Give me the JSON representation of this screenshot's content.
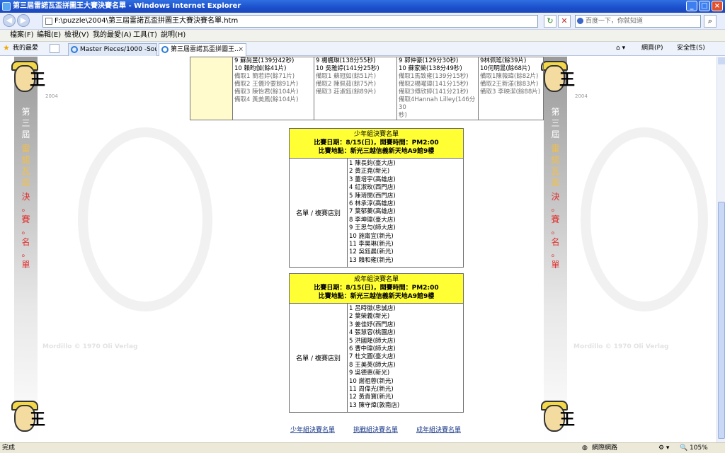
{
  "window": {
    "title": "第三屆雷諾瓦盃拼圖王大賽決賽名單 - Windows Internet Explorer"
  },
  "address": {
    "url": "F:\\puzzle\\2004\\第三屆雷諾瓦盃拼圖王大賽決賽名單.htm",
    "search_placeholder": "百度一下，你就知道"
  },
  "menu": [
    "檔案(F)",
    "編輯(E)",
    "檢視(V)",
    "我的最愛(A)",
    "工具(T)",
    "說明(H)"
  ],
  "favorites_label": "我的最愛",
  "tabs": [
    {
      "label": "Master Pieces/1000 -Soul of t..."
    },
    {
      "label": "第三屆雷諾瓦盃拼圖王..."
    }
  ],
  "toolbar_right": {
    "page": "網頁(P)",
    "safety": "安全性(S)"
  },
  "banner": {
    "vertical_top": [
      "第",
      "三",
      "屆"
    ],
    "vertical_gold": [
      "雷",
      "諾",
      "瓦",
      "盃"
    ],
    "vertical_red": [
      "決",
      "。",
      "賽",
      "。",
      "名",
      "。",
      "單"
    ],
    "year": "2004",
    "mascot_char": "王"
  },
  "watermark": {
    "copyright": "Mordillo © 1970 Oli Verlag"
  },
  "top_table": {
    "cols": [
      [
        "9 蘇尚昱(139分42秒)",
        "10 賴昀伽(餘41片)",
        "備取1 簡若婷(餘71片)",
        "備取2 王儀玲要餘91片)",
        "備取3 陳怡君(餘104片)",
        "備取4 黃美鳳(餘104片)"
      ],
      [
        "9 楊楓琳(138分55秒)",
        "10 吳雅婷(141分25秒)",
        "備取1 蘇冠如(餘51片)",
        "備取2 陳佩茹(餘75片)",
        "備取3 莊淑鈺(餘89片)"
      ],
      [
        "9 郭仲豪(129分30秒)",
        "10 蘇家榮(138分49秒)",
        "備取1馬致雍(139分15秒)",
        "備取2楊曜瑋(141分15秒)",
        "備取3傅欣婷(141分21秒)",
        "備取4Hannah Lilley(146分 30",
        "秒)"
      ],
      [
        "9林佩瑤(餘39片)",
        "10何明暠(餘68片)",
        "備取1陳薇瑋(餘82片)",
        "備取2王新漾(餘83片)",
        "備取3 李映潔(餘88片)"
      ]
    ]
  },
  "junior": {
    "title": "少年組決賽名單",
    "date_line": "比賽日期：8/15(日)，開賽時間：PM2:00",
    "venue_line": "比賽地點：新光三越信義新天地A9館9樓",
    "label": "名單 / 複賽店別",
    "names": [
      "1 陳長鈞(臺大店)",
      "2 黃正堯(新光)",
      "3 董培宇(高雄店)",
      "4 紅淑玫(西門店)",
      "5 陳琦閔(西門店)",
      "6 林承淳(高雄店)",
      "7 葉郁蓁(高雄店)",
      "8 李坤瑋(臺大店)",
      "9 王思勻(師大店)",
      "10 施甯宜(新光)",
      "11 李昊琳(新光)",
      "12 吳鈺晨(新光)",
      "13 賴和雍(新光)"
    ]
  },
  "adult": {
    "title": "成年組決賽名單",
    "date_line": "比賽日期：8/15(日)，開賽時間：PM2:00",
    "venue_line": "比賽地點：新光三越信義新天地A9館9樓",
    "label": "名單 / 複賽店別",
    "names": [
      "1 呂時徽(忠誠店)",
      "2 葉榮義(新光)",
      "3 姜佳妤(西門店)",
      "4 張慧容(桃園店)",
      "5 洪國隆(師大店)",
      "6 曹中瑋(師大店)",
      "7 杜文圓(臺大店)",
      "8 王美英(師大店)",
      "9 吳德惠(新光)",
      "10 謝祖蓉(新光)",
      "11 周偉光(新光)",
      "12 黃貴寶(新光)",
      "13 陳守煒(敦南店)"
    ]
  },
  "links": [
    "少年組決賽名單",
    "挑戰組決賽名單",
    "成年組決賽名單"
  ],
  "status": {
    "left": "完成",
    "zone": "網際網路",
    "zoom": "105%"
  }
}
